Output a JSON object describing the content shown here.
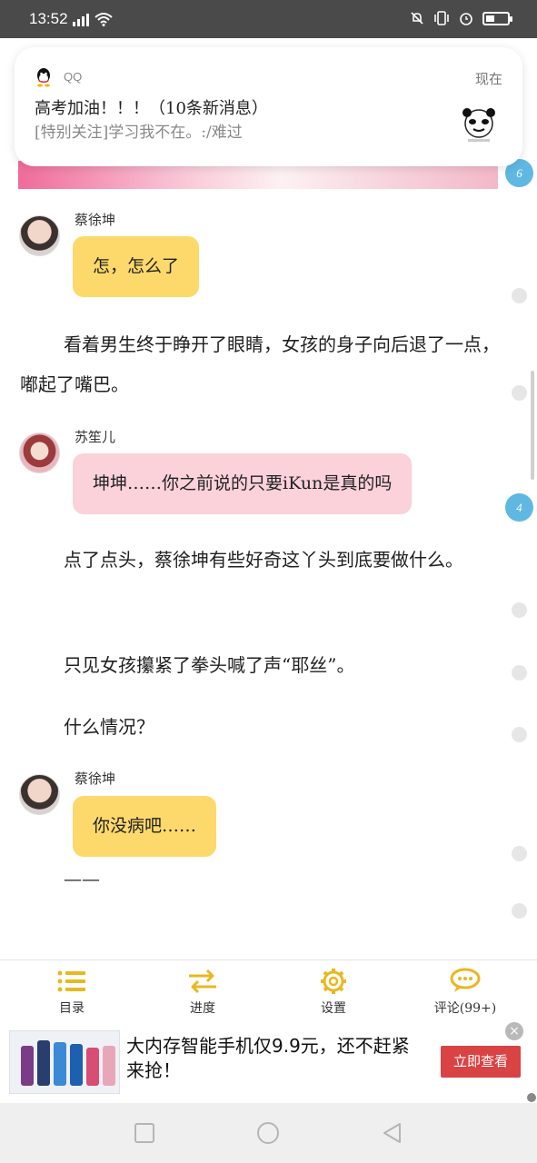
{
  "status_bar": {
    "time": "13:52",
    "battery_percent": 40
  },
  "notification": {
    "app": "QQ",
    "when": "现在",
    "title": "高考加油！！！（10条新消息）",
    "body": "[特别关注]学习我不在。:/难过"
  },
  "reader": {
    "badges": [
      "6",
      "4"
    ],
    "blocks": {
      "chat1": {
        "speaker": "蔡徐坤",
        "text": "怎，怎么了"
      },
      "para1": "看着男生终于睁开了眼睛，女孩的身子向后退了一点，嘟起了嘴巴。",
      "chat2": {
        "speaker": "苏笙儿",
        "text": "坤坤……你之前说的只要iKun是真的吗"
      },
      "para2": "点了点头，蔡徐坤有些好奇这丫头到底要做什么。",
      "para3": "只见女孩攥紧了拳头喊了声“耶丝”。",
      "para4": "什么情况？",
      "chat3": {
        "speaker": "蔡徐坤",
        "text": "你没病吧……"
      },
      "para5": "——"
    }
  },
  "toolbar": {
    "items": [
      {
        "label": "目录",
        "icon": "list-icon"
      },
      {
        "label": "进度",
        "icon": "swap-arrows-icon"
      },
      {
        "label": "设置",
        "icon": "gear-icon"
      },
      {
        "label": "评论(99+)",
        "icon": "chat-bubble-icon"
      }
    ],
    "accent": "#e9b81f"
  },
  "ad": {
    "text": "大内存智能手机仅9.9元，还不赶紧来抢！",
    "cta": "立即查看",
    "close": "×",
    "cta_color": "#d94343"
  },
  "nav_bar": {
    "buttons": [
      "recent-apps",
      "home",
      "back"
    ]
  }
}
